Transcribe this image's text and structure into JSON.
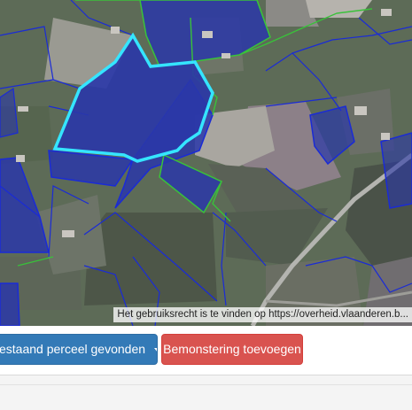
{
  "map": {
    "attribution": "Het gebruiksrecht is te vinden op https://overheid.vlaanderen.b...",
    "colors": {
      "parcel_fill": "#2a37a8",
      "parcel_border": "#1a2bd6",
      "selected_parcel_border": "#35e5ff",
      "other_parcel_border": "#39c23a"
    }
  },
  "toolbar": {
    "parcel_dropdown_label": "estaand perceel gevonden",
    "add_sampling_label": "Bemonstering toevoegen",
    "colors": {
      "primary": "#337ab7",
      "danger": "#d9534f"
    }
  }
}
